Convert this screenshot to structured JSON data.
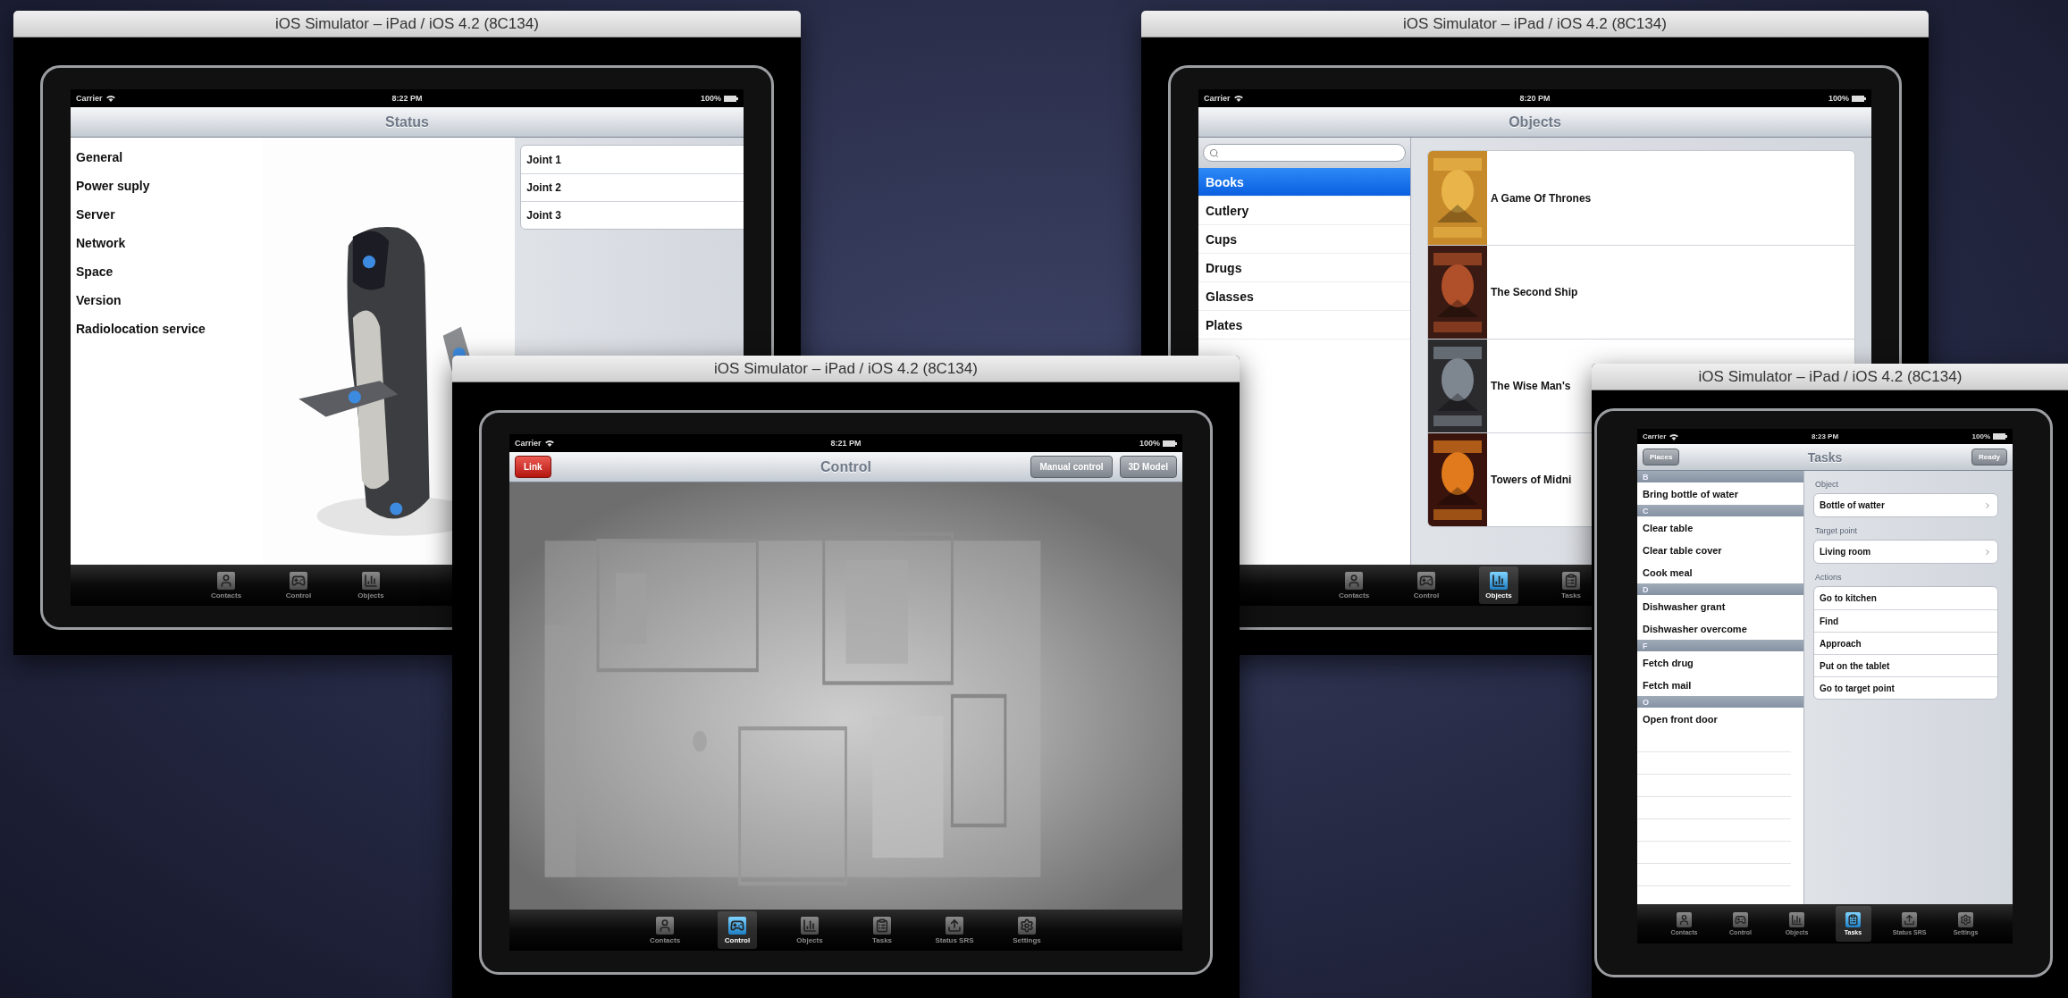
{
  "windows": [
    {
      "kind": "status",
      "title": "iOS Simulator – iPad / iOS 4.2 (8C134)",
      "status_bar": {
        "carrier": "Carrier",
        "time": "8:22 PM",
        "battery": "100%"
      },
      "nav": {
        "title": "Status"
      },
      "menu": [
        "General",
        "Power suply",
        "Server",
        "Network",
        "Space",
        "Version",
        "Radiolocation service"
      ],
      "joints": [
        "Joint 1",
        "Joint 2",
        "Joint 3"
      ],
      "tabs": [
        {
          "label": "Contacts",
          "selected": false
        },
        {
          "label": "Control",
          "selected": false
        },
        {
          "label": "Objects",
          "selected": false
        }
      ]
    },
    {
      "kind": "objects",
      "title": "iOS Simulator – iPad / iOS 4.2 (8C134)",
      "status_bar": {
        "carrier": "Carrier",
        "time": "8:20 PM",
        "battery": "100%"
      },
      "nav": {
        "title": "Objects"
      },
      "categories": [
        {
          "label": "Books",
          "selected": true
        },
        {
          "label": "Cutlery",
          "selected": false
        },
        {
          "label": "Cups",
          "selected": false
        },
        {
          "label": "Drugs",
          "selected": false
        },
        {
          "label": "Glasses",
          "selected": false
        },
        {
          "label": "Plates",
          "selected": false
        }
      ],
      "books": [
        "A Game Of Thrones",
        "The Second Ship",
        "The Wise Man's",
        "Towers of Midni"
      ],
      "tabs": [
        {
          "label": "Contacts",
          "selected": false
        },
        {
          "label": "Control",
          "selected": false
        },
        {
          "label": "Objects",
          "selected": true
        },
        {
          "label": "Tasks",
          "selected": false
        }
      ]
    },
    {
      "kind": "control",
      "title": "iOS Simulator – iPad / iOS 4.2 (8C134)",
      "status_bar": {
        "carrier": "Carrier",
        "time": "8:21 PM",
        "battery": "100%"
      },
      "nav": {
        "title": "Control",
        "left_button": {
          "label": "Link",
          "kind": "destructive"
        },
        "right_buttons": [
          "Manual control",
          "3D Model"
        ]
      },
      "tabs": [
        {
          "label": "Contacts",
          "selected": false
        },
        {
          "label": "Control",
          "selected": true
        },
        {
          "label": "Objects",
          "selected": false
        },
        {
          "label": "Tasks",
          "selected": false
        },
        {
          "label": "Status SRS",
          "selected": false
        },
        {
          "label": "Settings",
          "selected": false
        }
      ]
    },
    {
      "kind": "tasks",
      "title": "iOS Simulator – iPad / iOS 4.2 (8C134)",
      "status_bar": {
        "carrier": "Carrier",
        "time": "8:23 PM",
        "battery": "100%"
      },
      "nav": {
        "title": "Tasks",
        "left_button": {
          "label": "Places",
          "kind": "plain"
        },
        "right_buttons": [
          "Ready"
        ]
      },
      "sections": [
        {
          "header": "B",
          "rows": [
            "Bring bottle of water"
          ]
        },
        {
          "header": "C",
          "rows": [
            "Clear table",
            "Clear table cover",
            "Cook meal"
          ]
        },
        {
          "header": "D",
          "rows": [
            "Dishwasher grant",
            "Dishwasher overcome"
          ]
        },
        {
          "header": "F",
          "rows": [
            "Fetch drug",
            "Fetch mail"
          ]
        },
        {
          "header": "O",
          "rows": [
            "Open front door"
          ]
        }
      ],
      "groups": [
        {
          "header": "Object",
          "rows": [
            {
              "label": "Bottle of watter",
              "kind": "disclosure"
            }
          ]
        },
        {
          "header": "Target point",
          "rows": [
            {
              "label": "Living room",
              "kind": "disclosure"
            }
          ]
        },
        {
          "header": "Actions",
          "rows": [
            {
              "label": "Go to kitchen",
              "kind": "action"
            },
            {
              "label": "Find",
              "kind": "action"
            },
            {
              "label": "Approach",
              "kind": "action"
            },
            {
              "label": "Put on the tablet",
              "kind": "action"
            },
            {
              "label": "Go to target point",
              "kind": "action"
            }
          ]
        }
      ],
      "tabs": [
        {
          "label": "Contacts",
          "selected": false
        },
        {
          "label": "Control",
          "selected": false
        },
        {
          "label": "Objects",
          "selected": false
        },
        {
          "label": "Tasks",
          "selected": true
        },
        {
          "label": "Status SRS",
          "selected": false
        },
        {
          "label": "Settings",
          "selected": false
        }
      ]
    }
  ]
}
